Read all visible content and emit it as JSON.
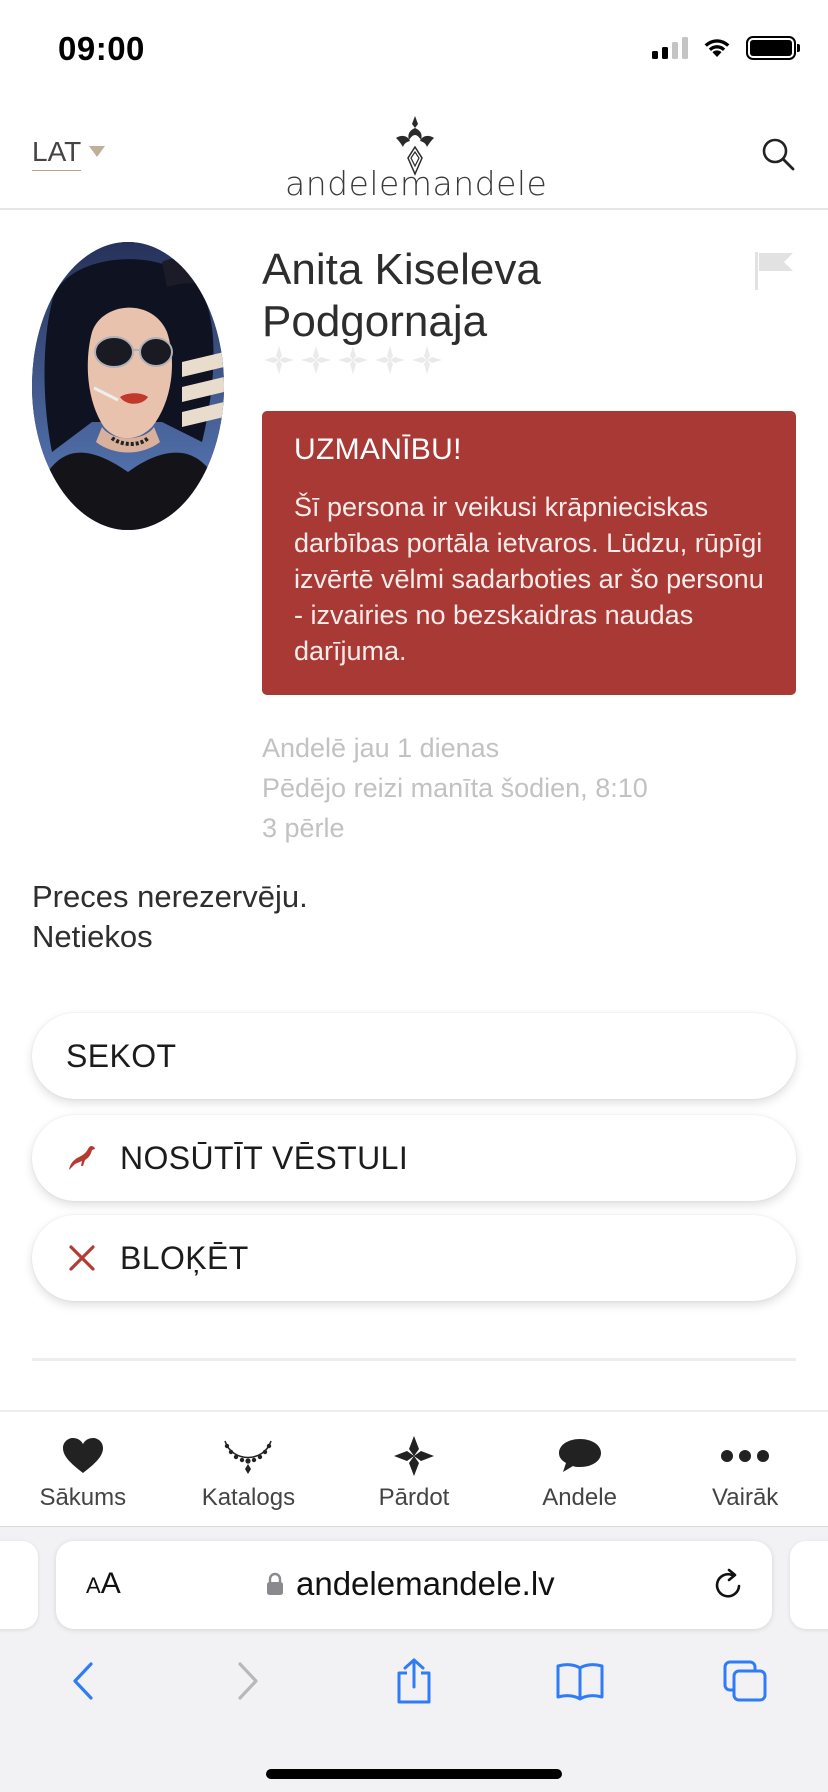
{
  "status_bar": {
    "time": "09:00"
  },
  "header": {
    "language": "LAT",
    "logo_text": "andelemandele"
  },
  "profile": {
    "name": "Anita Kiseleva Podgornaja",
    "rating_stars": 5,
    "warning": {
      "title": "UZMANĪBU!",
      "text": "Šī persona ir veikusi krāpnieciskas darbības portāla ietvaros. Lūdzu, rūpīgi izvērtē vēlmi sadarboties ar šo personu - izvairies no bezskaidras naudas darījuma."
    },
    "meta": {
      "member_since": "Andelē jau 1 dienas",
      "last_seen": "Pēdējo reizi manīta šodien, 8:10",
      "pearls": "3 pērle"
    },
    "bio_line1": "Preces nerezervēju.",
    "bio_line2": "Netiekos"
  },
  "actions": {
    "follow": "SEKOT",
    "message": "NOSŪTĪT VĒSTULI",
    "block": "BLOĶĒT"
  },
  "bottom_nav": [
    {
      "label": "Sākums",
      "icon": "heart-icon"
    },
    {
      "label": "Katalogs",
      "icon": "necklace-icon"
    },
    {
      "label": "Pārdot",
      "icon": "diamond-cross-icon"
    },
    {
      "label": "Andele",
      "icon": "chat-bubble-icon"
    },
    {
      "label": "Vairāk",
      "icon": "more-dots-icon"
    }
  ],
  "browser": {
    "text_size_label_small": "A",
    "text_size_label_large": "A",
    "url": "andelemandele.lv"
  },
  "colors": {
    "warning_bg": "#a83935",
    "brand_red": "#b53a32",
    "ios_blue": "#2f7cf6"
  }
}
